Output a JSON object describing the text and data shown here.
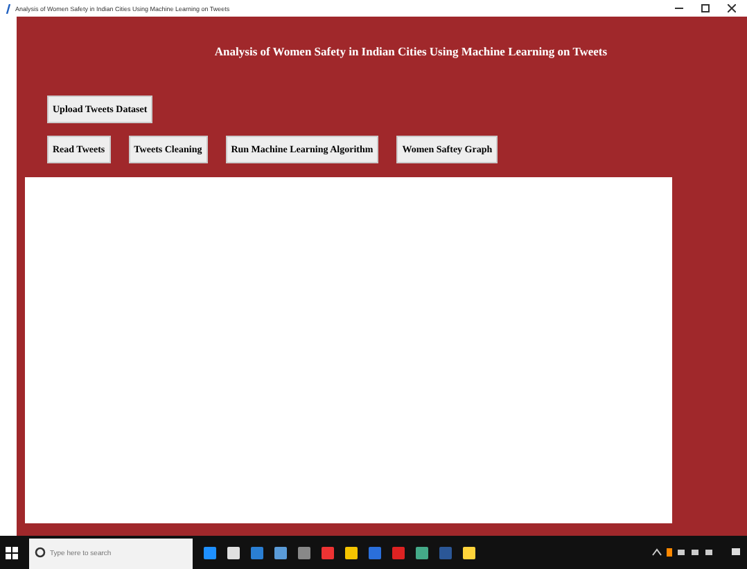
{
  "window": {
    "title": "Analysis of Women Safety in Indian Cities Using Machine Learning on Tweets"
  },
  "heading": "Analysis of Women Safety in Indian Cities Using Machine Learning on Tweets",
  "button_rows": [
    [
      "Upload Tweets Dataset"
    ],
    [
      "Read Tweets",
      "Tweets Cleaning",
      "Run Machine Learning Algorithm",
      "Women Saftey Graph"
    ]
  ],
  "taskbar": {
    "search_placeholder": "Type here to search"
  }
}
